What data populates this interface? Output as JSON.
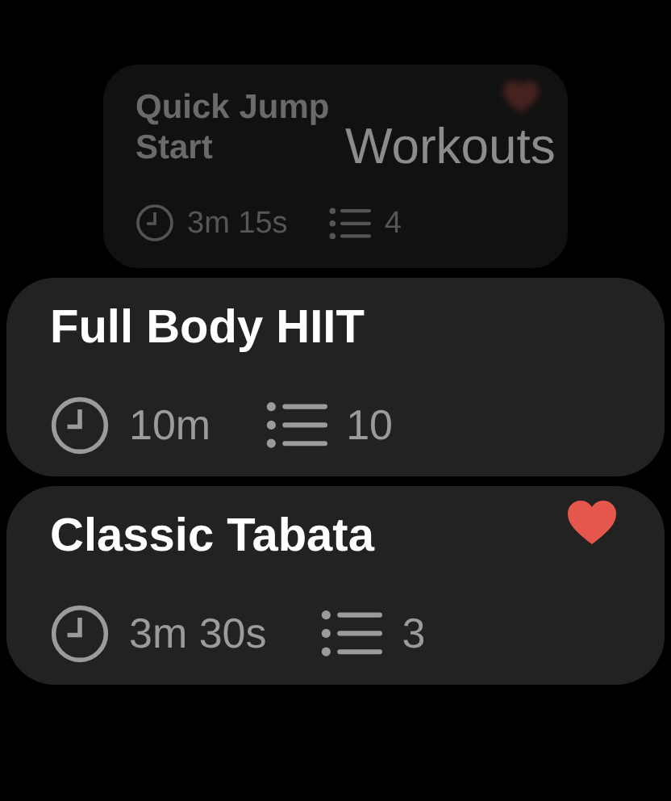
{
  "title": "Workouts",
  "workouts": [
    {
      "name": "Quick Jump Start",
      "duration": "3m 15s",
      "intervals": "4",
      "favorite": true,
      "receding": true
    },
    {
      "name": "Full Body HIIT",
      "duration": "10m",
      "intervals": "10",
      "favorite": false,
      "receding": false
    },
    {
      "name": "Classic Tabata",
      "duration": "3m 30s",
      "intervals": "3",
      "favorite": true,
      "receding": false
    }
  ]
}
